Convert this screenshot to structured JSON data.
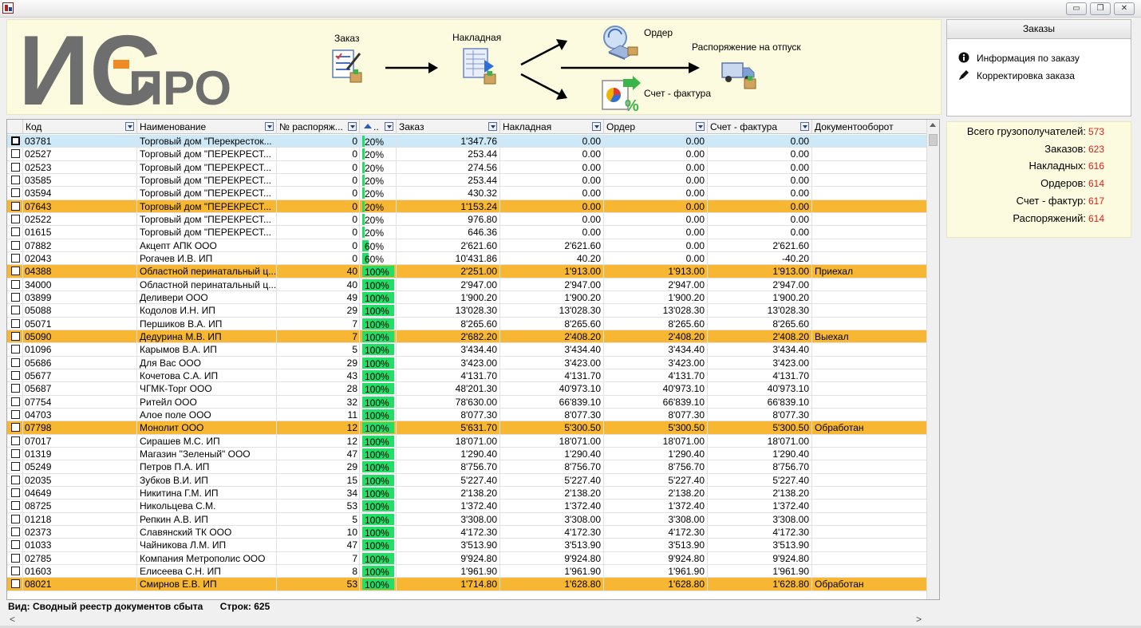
{
  "window": {
    "minimize_glyph": "▭",
    "restore_glyph": "❐",
    "close_glyph": "✕"
  },
  "logo": {
    "text_main": "ИС",
    "text_tail": "ПРО",
    "color_gray": "#6e6e6e",
    "color_orange": "#f08a24"
  },
  "workflow": {
    "order_label": "Заказ",
    "invoice_label": "Накладная",
    "cash_order_label": "Ордер",
    "release_label": "Распоряжение на отпуск",
    "tax_invoice_label": "Счет - фактура"
  },
  "orders_panel": {
    "title": "Заказы",
    "actions": [
      {
        "label": "Информация по заказу",
        "icon": "info-icon"
      },
      {
        "label": "Корректировка заказа",
        "icon": "pencil-icon"
      }
    ]
  },
  "stats": [
    {
      "label": "Всего грузополучателей:",
      "value": "573"
    },
    {
      "label": "Заказов:",
      "value": "623"
    },
    {
      "label": "Накладных:",
      "value": "616"
    },
    {
      "label": "Ордеров:",
      "value": "614"
    },
    {
      "label": "Счет - фактур:",
      "value": "617"
    },
    {
      "label": "Распоряжений:",
      "value": "614"
    }
  ],
  "grid": {
    "columns": [
      "Код",
      "Наименование",
      "№ распоряж...",
      "..",
      "Заказ",
      "Накладная",
      "Ордер",
      "Счет - фактура",
      "Документооборот"
    ],
    "rows": [
      {
        "kod": "03781",
        "name": "Торговый дом \"Перекресток...",
        "nr": "0",
        "pct": 20,
        "pct_label": "20%",
        "zak": "1'347.76",
        "nak": "0.00",
        "ord": "0.00",
        "sf": "0.00",
        "doc": "",
        "style": "sel"
      },
      {
        "kod": "02527",
        "name": "Торговый дом \"ПЕРЕКРЕСТ...",
        "nr": "0",
        "pct": 20,
        "pct_label": "20%",
        "zak": "253.44",
        "nak": "0.00",
        "ord": "0.00",
        "sf": "0.00",
        "doc": "",
        "style": ""
      },
      {
        "kod": "02523",
        "name": "Торговый дом \"ПЕРЕКРЕСТ...",
        "nr": "0",
        "pct": 20,
        "pct_label": "20%",
        "zak": "274.56",
        "nak": "0.00",
        "ord": "0.00",
        "sf": "0.00",
        "doc": "",
        "style": ""
      },
      {
        "kod": "03585",
        "name": "Торговый дом \"ПЕРЕКРЕСТ...",
        "nr": "0",
        "pct": 20,
        "pct_label": "20%",
        "zak": "253.44",
        "nak": "0.00",
        "ord": "0.00",
        "sf": "0.00",
        "doc": "",
        "style": ""
      },
      {
        "kod": "03594",
        "name": "Торговый дом \"ПЕРЕКРЕСТ...",
        "nr": "0",
        "pct": 20,
        "pct_label": "20%",
        "zak": "430.32",
        "nak": "0.00",
        "ord": "0.00",
        "sf": "0.00",
        "doc": "",
        "style": ""
      },
      {
        "kod": "07643",
        "name": "Торговый дом \"ПЕРЕКРЕСТ...",
        "nr": "0",
        "pct": 20,
        "pct_label": "20%",
        "zak": "1'153.24",
        "nak": "0.00",
        "ord": "0.00",
        "sf": "0.00",
        "doc": "",
        "style": "hl"
      },
      {
        "kod": "02522",
        "name": "Торговый дом \"ПЕРЕКРЕСТ...",
        "nr": "0",
        "pct": 20,
        "pct_label": "20%",
        "zak": "976.80",
        "nak": "0.00",
        "ord": "0.00",
        "sf": "0.00",
        "doc": "",
        "style": ""
      },
      {
        "kod": "01615",
        "name": "Торговый дом \"ПЕРЕКРЕСТ...",
        "nr": "0",
        "pct": 20,
        "pct_label": "20%",
        "zak": "646.36",
        "nak": "0.00",
        "ord": "0.00",
        "sf": "0.00",
        "doc": "",
        "style": ""
      },
      {
        "kod": "07882",
        "name": "Акцепт АПК ООО",
        "nr": "0",
        "pct": 60,
        "pct_label": "60%",
        "zak": "2'621.60",
        "nak": "2'621.60",
        "ord": "0.00",
        "sf": "2'621.60",
        "doc": "",
        "style": ""
      },
      {
        "kod": "02043",
        "name": "Рогачев И.В. ИП",
        "nr": "0",
        "pct": 60,
        "pct_label": "60%",
        "zak": "10'431.86",
        "nak": "40.20",
        "ord": "0.00",
        "sf": "-40.20",
        "doc": "",
        "style": ""
      },
      {
        "kod": "04388",
        "name": "Областной перинатальный ц...",
        "nr": "40",
        "pct": 100,
        "pct_label": "100%",
        "zak": "2'251.00",
        "nak": "1'913.00",
        "ord": "1'913.00",
        "sf": "1'913.00",
        "doc": "Приехал",
        "style": "hl"
      },
      {
        "kod": "34000",
        "name": "Областной перинатальный ц...",
        "nr": "40",
        "pct": 100,
        "pct_label": "100%",
        "zak": "2'947.00",
        "nak": "2'947.00",
        "ord": "2'947.00",
        "sf": "2'947.00",
        "doc": "",
        "style": ""
      },
      {
        "kod": "03899",
        "name": "Деливери ООО",
        "nr": "49",
        "pct": 100,
        "pct_label": "100%",
        "zak": "1'900.20",
        "nak": "1'900.20",
        "ord": "1'900.20",
        "sf": "1'900.20",
        "doc": "",
        "style": ""
      },
      {
        "kod": "05088",
        "name": "Кодолов И.Н. ИП",
        "nr": "29",
        "pct": 100,
        "pct_label": "100%",
        "zak": "13'028.30",
        "nak": "13'028.30",
        "ord": "13'028.30",
        "sf": "13'028.30",
        "doc": "",
        "style": ""
      },
      {
        "kod": "05071",
        "name": "Першиков В.А. ИП",
        "nr": "7",
        "pct": 100,
        "pct_label": "100%",
        "zak": "8'265.60",
        "nak": "8'265.60",
        "ord": "8'265.60",
        "sf": "8'265.60",
        "doc": "",
        "style": ""
      },
      {
        "kod": "05090",
        "name": "Дедурина М.В. ИП",
        "nr": "7",
        "pct": 100,
        "pct_label": "100%",
        "zak": "2'682.20",
        "nak": "2'408.20",
        "ord": "2'408.20",
        "sf": "2'408.20",
        "doc": "Выехал",
        "style": "hl"
      },
      {
        "kod": "01096",
        "name": "Карымов В.А. ИП",
        "nr": "5",
        "pct": 100,
        "pct_label": "100%",
        "zak": "3'434.40",
        "nak": "3'434.40",
        "ord": "3'434.40",
        "sf": "3'434.40",
        "doc": "",
        "style": ""
      },
      {
        "kod": "05686",
        "name": "Для Вас ООО",
        "nr": "29",
        "pct": 100,
        "pct_label": "100%",
        "zak": "3'423.00",
        "nak": "3'423.00",
        "ord": "3'423.00",
        "sf": "3'423.00",
        "doc": "",
        "style": ""
      },
      {
        "kod": "05677",
        "name": "Кочетова С.А. ИП",
        "nr": "43",
        "pct": 100,
        "pct_label": "100%",
        "zak": "4'131.70",
        "nak": "4'131.70",
        "ord": "4'131.70",
        "sf": "4'131.70",
        "doc": "",
        "style": ""
      },
      {
        "kod": "05687",
        "name": "ЧГМК-Торг ООО",
        "nr": "28",
        "pct": 100,
        "pct_label": "100%",
        "zak": "48'201.30",
        "nak": "40'973.10",
        "ord": "40'973.10",
        "sf": "40'973.10",
        "doc": "",
        "style": ""
      },
      {
        "kod": "07754",
        "name": "Ритейл ООО",
        "nr": "32",
        "pct": 100,
        "pct_label": "100%",
        "zak": "78'630.00",
        "nak": "66'839.10",
        "ord": "66'839.10",
        "sf": "66'839.10",
        "doc": "",
        "style": ""
      },
      {
        "kod": "04703",
        "name": "Алое поле ООО",
        "nr": "11",
        "pct": 100,
        "pct_label": "100%",
        "zak": "8'077.30",
        "nak": "8'077.30",
        "ord": "8'077.30",
        "sf": "8'077.30",
        "doc": "",
        "style": ""
      },
      {
        "kod": "07798",
        "name": "Монолит ООО",
        "nr": "12",
        "pct": 100,
        "pct_label": "100%",
        "zak": "5'631.70",
        "nak": "5'300.50",
        "ord": "5'300.50",
        "sf": "5'300.50",
        "doc": "Обработан",
        "style": "hl"
      },
      {
        "kod": "07017",
        "name": "Сирашев М.С. ИП",
        "nr": "12",
        "pct": 100,
        "pct_label": "100%",
        "zak": "18'071.00",
        "nak": "18'071.00",
        "ord": "18'071.00",
        "sf": "18'071.00",
        "doc": "",
        "style": ""
      },
      {
        "kod": "01319",
        "name": "Магазин \"Зеленый\" ООО",
        "nr": "47",
        "pct": 100,
        "pct_label": "100%",
        "zak": "1'290.40",
        "nak": "1'290.40",
        "ord": "1'290.40",
        "sf": "1'290.40",
        "doc": "",
        "style": ""
      },
      {
        "kod": "05249",
        "name": "Петров П.А. ИП",
        "nr": "29",
        "pct": 100,
        "pct_label": "100%",
        "zak": "8'756.70",
        "nak": "8'756.70",
        "ord": "8'756.70",
        "sf": "8'756.70",
        "doc": "",
        "style": ""
      },
      {
        "kod": "02035",
        "name": "Зубков В.И. ИП",
        "nr": "15",
        "pct": 100,
        "pct_label": "100%",
        "zak": "5'227.40",
        "nak": "5'227.40",
        "ord": "5'227.40",
        "sf": "5'227.40",
        "doc": "",
        "style": ""
      },
      {
        "kod": "04649",
        "name": "Никитина Г.М. ИП",
        "nr": "34",
        "pct": 100,
        "pct_label": "100%",
        "zak": "2'138.20",
        "nak": "2'138.20",
        "ord": "2'138.20",
        "sf": "2'138.20",
        "doc": "",
        "style": ""
      },
      {
        "kod": "08725",
        "name": "Никольцева С.М.",
        "nr": "53",
        "pct": 100,
        "pct_label": "100%",
        "zak": "1'372.40",
        "nak": "1'372.40",
        "ord": "1'372.40",
        "sf": "1'372.40",
        "doc": "",
        "style": ""
      },
      {
        "kod": "01218",
        "name": "Репкин А.В. ИП",
        "nr": "5",
        "pct": 100,
        "pct_label": "100%",
        "zak": "3'308.00",
        "nak": "3'308.00",
        "ord": "3'308.00",
        "sf": "3'308.00",
        "doc": "",
        "style": ""
      },
      {
        "kod": "02373",
        "name": "Славянский ТК ООО",
        "nr": "10",
        "pct": 100,
        "pct_label": "100%",
        "zak": "4'172.30",
        "nak": "4'172.30",
        "ord": "4'172.30",
        "sf": "4'172.30",
        "doc": "",
        "style": ""
      },
      {
        "kod": "01033",
        "name": "Чайникова Л.М. ИП",
        "nr": "47",
        "pct": 100,
        "pct_label": "100%",
        "zak": "3'513.90",
        "nak": "3'513.90",
        "ord": "3'513.90",
        "sf": "3'513.90",
        "doc": "",
        "style": ""
      },
      {
        "kod": "02785",
        "name": "Компания Метрополис ООО",
        "nr": "7",
        "pct": 100,
        "pct_label": "100%",
        "zak": "9'924.80",
        "nak": "9'924.80",
        "ord": "9'924.80",
        "sf": "9'924.80",
        "doc": "",
        "style": ""
      },
      {
        "kod": "01603",
        "name": "Елисеева С.Н. ИП",
        "nr": "8",
        "pct": 100,
        "pct_label": "100%",
        "zak": "1'961.90",
        "nak": "1'961.90",
        "ord": "1'961.90",
        "sf": "1'961.90",
        "doc": "",
        "style": ""
      },
      {
        "kod": "08021",
        "name": "Смирнов Е.В. ИП",
        "nr": "53",
        "pct": 100,
        "pct_label": "100%",
        "zak": "1'714.80",
        "nak": "1'628.80",
        "ord": "1'628.80",
        "sf": "1'628.80",
        "doc": "Обработан",
        "style": "hl"
      }
    ]
  },
  "status": {
    "view_label": "Вид: Сводный реестр документов сбыта",
    "rows_label": "Строк: 625"
  },
  "scroll": {
    "left_glyph": "<",
    "right_glyph": ">"
  },
  "colors": {
    "highlight_row": "#f7b733",
    "selected_row": "#cde8f7",
    "progress": "#22dd66",
    "stat_value": "#e0201a",
    "header_bg": "#fcfbdf"
  }
}
